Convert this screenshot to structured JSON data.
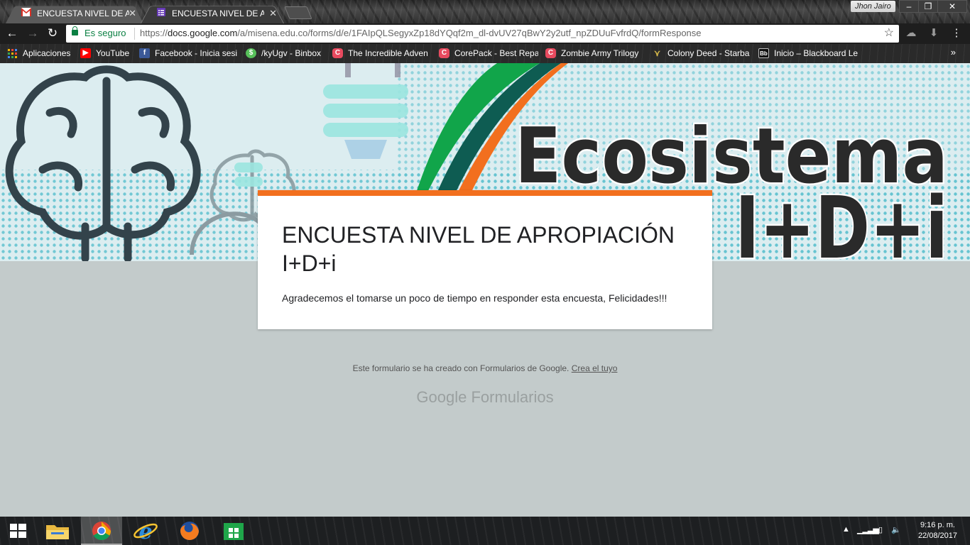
{
  "browser": {
    "tabs": [
      {
        "title": "ENCUESTA NIVEL DE APROPIACIÓN I+D+i",
        "icon": "gmail-icon",
        "active": false
      },
      {
        "title": "ENCUESTA NIVEL DE APROPIACIÓN I+D+i",
        "icon": "google-forms-icon",
        "active": true
      }
    ],
    "user_name": "Jhon Jairo",
    "secure_label": "Es seguro",
    "url_scheme": "https://",
    "url_host": "docs.google.com",
    "url_path": "/a/misena.edu.co/forms/d/e/1FAIpQLSegyxZp18dYQqf2m_dl-dvUV27qBwY2y2utf_npZDUuFvfrdQ/formResponse",
    "bookmarks": [
      {
        "label": "Aplicaciones",
        "icon": "apps-grid-icon",
        "color": "#f4b400"
      },
      {
        "label": "YouTube",
        "icon": "youtube-icon",
        "color": "#ff0000"
      },
      {
        "label": "Facebook - Inicia sesi",
        "icon": "facebook-icon",
        "color": "#3b5998"
      },
      {
        "label": "/kyUgv - Binbox",
        "icon": "binbox-icon",
        "color": "#57c05a"
      },
      {
        "label": "The Incredible Adven",
        "icon": "game-c-icon",
        "color": "#e84a5f"
      },
      {
        "label": "CorePack - Best Repa",
        "icon": "game-c-icon",
        "color": "#e84a5f"
      },
      {
        "label": "Zombie Army Trilogy",
        "icon": "game-c-icon",
        "color": "#e84a5f"
      },
      {
        "label": "Colony Deed - Starba",
        "icon": "starbase-icon",
        "color": "#d6b94a"
      },
      {
        "label": "Inicio – Blackboard Le",
        "icon": "blackboard-icon",
        "color": "#222222"
      }
    ],
    "more_bookmarks": "»"
  },
  "banner": {
    "title": "Ecosistema",
    "subtitle": "I+D+i"
  },
  "form": {
    "title": "ENCUESTA NIVEL DE APROPIACIÓN I+D+i",
    "description": "Agradecemos el tomarse un poco de tiempo en responder esta encuesta, Felicidades!!!",
    "accent_color": "#f26f1e"
  },
  "footer": {
    "note": "Este formulario se ha creado con Formularios de Google.",
    "link": "Crea el tuyo",
    "logo_google": "Google",
    "logo_product": "Formularios"
  },
  "taskbar": {
    "apps": [
      "start-icon",
      "file-explorer-icon",
      "chrome-icon",
      "internet-explorer-icon",
      "firefox-icon",
      "store-icon"
    ],
    "time": "9:16 p. m.",
    "date": "22/08/2017"
  }
}
